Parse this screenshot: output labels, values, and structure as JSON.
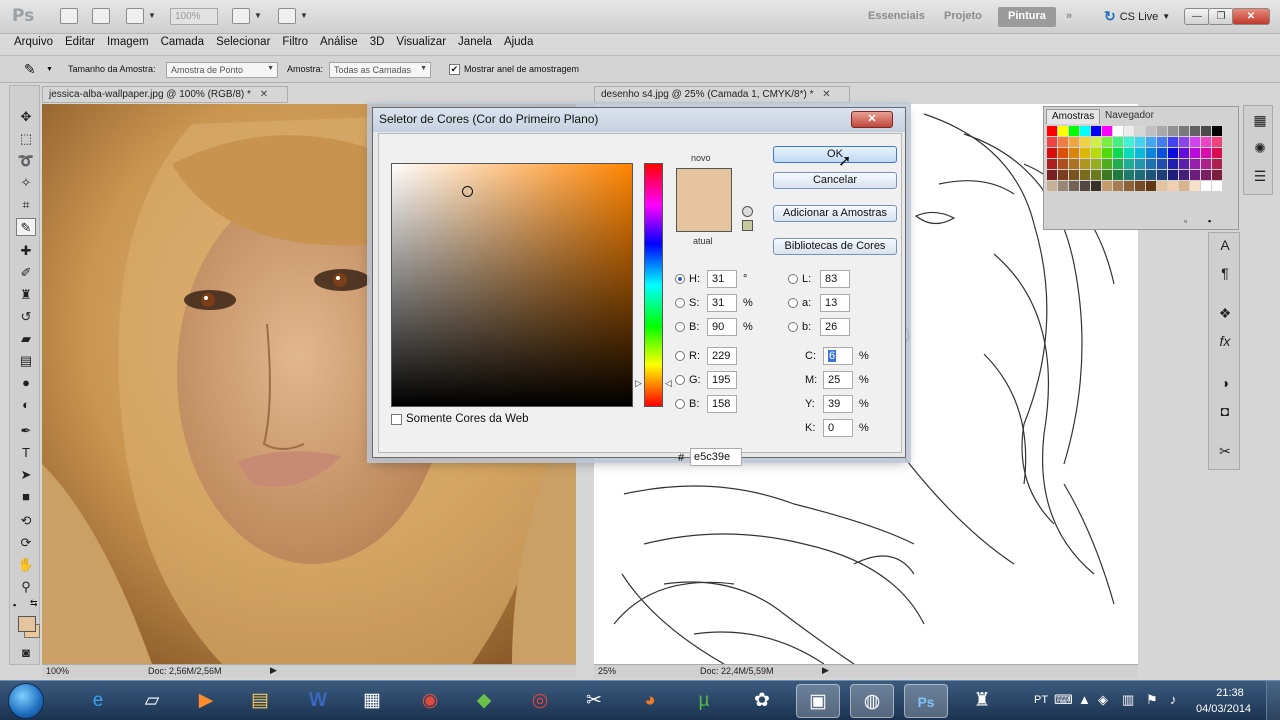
{
  "app": {
    "logo": "Ps",
    "zoom": "100%",
    "workspaces": [
      "Essenciais",
      "Projeto",
      "Pintura"
    ],
    "more": "»",
    "cs_live": "CS Live",
    "window_buttons": {
      "minimize": "—",
      "restore": "❐",
      "close": "✕"
    }
  },
  "menu": [
    "Arquivo",
    "Editar",
    "Imagem",
    "Camada",
    "Selecionar",
    "Filtro",
    "Análise",
    "3D",
    "Visualizar",
    "Janela",
    "Ajuda"
  ],
  "options": {
    "sample_size_label": "Tamanho da Amostra:",
    "sample_size_value": "Amostra de Ponto",
    "sample_label": "Amostra:",
    "sample_value": "Todas as Camadas",
    "ring_checked": "✔",
    "ring_label": "Mostrar anel de amostragem"
  },
  "documents": [
    {
      "tab": "jessica-alba-wallpaper.jpg @ 100% (RGB/8) *",
      "close": "✕",
      "zoom": "100%",
      "doc": "Doc: 2,56M/2,56M"
    },
    {
      "tab": "desenho s4.jpg @ 25% (Camada 1, CMYK/8*) *",
      "close": "✕",
      "zoom": "25%",
      "doc": "Doc: 22,4M/5,59M"
    }
  ],
  "panels": {
    "tabs": [
      "Amostras",
      "Navegador"
    ]
  },
  "dialog": {
    "title": "Seletor de Cores (Cor do Primeiro Plano)",
    "close": "✕",
    "new_label": "novo",
    "current_label": "atual",
    "new_color": "#e5c39e",
    "current_color": "#e5c39e",
    "buttons": {
      "ok": "OK",
      "cancel": "Cancelar",
      "add": "Adicionar a Amostras",
      "libraries": "Bibliotecas de Cores"
    },
    "hsb": [
      {
        "label": "H:",
        "value": "31",
        "unit": "°",
        "selected": true
      },
      {
        "label": "S:",
        "value": "31",
        "unit": "%",
        "selected": false
      },
      {
        "label": "B:",
        "value": "90",
        "unit": "%",
        "selected": false
      }
    ],
    "rgb": [
      {
        "label": "R:",
        "value": "229"
      },
      {
        "label": "G:",
        "value": "195"
      },
      {
        "label": "B:",
        "value": "158"
      }
    ],
    "lab": [
      {
        "label": "L:",
        "value": "83"
      },
      {
        "label": "a:",
        "value": "13"
      },
      {
        "label": "b:",
        "value": "26"
      }
    ],
    "cmyk": [
      {
        "label": "C:",
        "value": "6",
        "unit": "%"
      },
      {
        "label": "M:",
        "value": "25",
        "unit": "%"
      },
      {
        "label": "Y:",
        "value": "39",
        "unit": "%"
      },
      {
        "label": "K:",
        "value": "0",
        "unit": "%"
      }
    ],
    "web_only_label": "Somente Cores da Web",
    "hex_symbol": "#",
    "hex": "e5c39e"
  },
  "taskbar": {
    "lang": "PT",
    "time": "21:38",
    "date": "04/03/2014"
  }
}
